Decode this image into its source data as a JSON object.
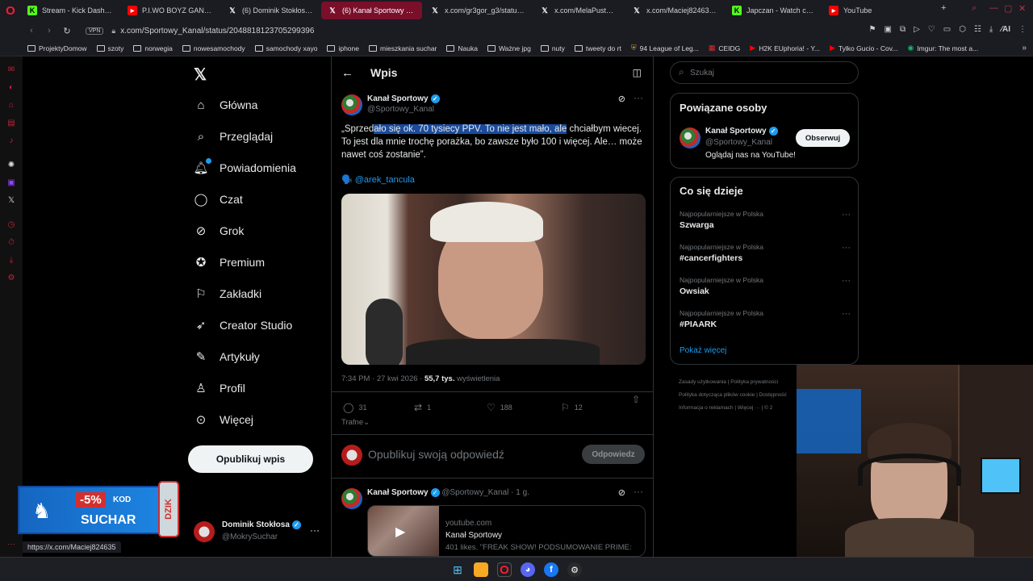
{
  "browser": {
    "tabs": [
      {
        "label": "Stream - Kick Dashboard",
        "icon": "kick-icon",
        "color": "#53fc18"
      },
      {
        "label": "P.I.WO BOYZ GANG - S20",
        "icon": "youtube-icon",
        "color": "#ff0000"
      },
      {
        "label": "(6) Dominik Stokłosa (@M",
        "icon": "x-icon",
        "color": "#ffffff"
      },
      {
        "label": "(6) Kanał Sportowy w ser",
        "icon": "x-icon",
        "color": "#ffffff",
        "active": true
      },
      {
        "label": "x.com/gr3gor_g3/status/2",
        "icon": "x-icon",
        "color": "#ffffff"
      },
      {
        "label": "x.com/MelaPustelnik/stat",
        "icon": "x-icon",
        "color": "#ffffff"
      },
      {
        "label": "x.com/Maciej824635/stat",
        "icon": "x-icon",
        "color": "#ffffff"
      },
      {
        "label": "Japczan - Watch clips on",
        "icon": "kick-icon",
        "color": "#53fc18"
      },
      {
        "label": "YouTube",
        "icon": "youtube-icon",
        "color": "#ff0000"
      }
    ],
    "vpn_label": "VPN",
    "url": "x.com/Sportowy_Kanal/status/2048818123705299396",
    "bookmarks": [
      {
        "label": "ProjektyDomow",
        "icon": "folder-icon"
      },
      {
        "label": "szoty",
        "icon": "folder-icon"
      },
      {
        "label": "norwegia",
        "icon": "folder-icon"
      },
      {
        "label": "nowesamochody",
        "icon": "folder-icon"
      },
      {
        "label": "samochody xayo",
        "icon": "folder-icon"
      },
      {
        "label": "iphone",
        "icon": "folder-icon"
      },
      {
        "label": "mieszkania suchar",
        "icon": "folder-icon"
      },
      {
        "label": "Nauka",
        "icon": "folder-icon"
      },
      {
        "label": "Ważne jpg",
        "icon": "folder-icon"
      },
      {
        "label": "nuty",
        "icon": "folder-icon"
      },
      {
        "label": "tweety do rt",
        "icon": "folder-icon"
      },
      {
        "label": "94 League of Leg...",
        "icon": "league-icon"
      },
      {
        "label": "CEIDG",
        "icon": "ceidg-icon"
      },
      {
        "label": "H2K EUphoria! - Y...",
        "icon": "youtube-icon"
      },
      {
        "label": "Tylko Gucio - Cov...",
        "icon": "youtube-icon"
      },
      {
        "label": "Imgur: The most a...",
        "icon": "imgur-icon"
      }
    ],
    "status_url": "https://x.com/Maciej824635"
  },
  "twitter": {
    "nav": [
      {
        "label": "Główna",
        "icon": "home-icon"
      },
      {
        "label": "Przeglądaj",
        "icon": "search-icon"
      },
      {
        "label": "Powiadomienia",
        "icon": "bell-icon"
      },
      {
        "label": "Czat",
        "icon": "chat-icon"
      },
      {
        "label": "Grok",
        "icon": "grok-icon"
      },
      {
        "label": "Premium",
        "icon": "premium-icon"
      },
      {
        "label": "Zakładki",
        "icon": "bookmark-icon"
      },
      {
        "label": "Creator Studio",
        "icon": "rocket-icon"
      },
      {
        "label": "Artykuły",
        "icon": "article-icon"
      },
      {
        "label": "Profil",
        "icon": "profile-icon"
      },
      {
        "label": "Więcej",
        "icon": "more-icon"
      }
    ],
    "post_button": "Opublikuj wpis",
    "account": {
      "name": "Dominik Stokłosa",
      "handle": "@MokrySuchar"
    },
    "ad": {
      "discount": "-5%",
      "code_label": "KOD",
      "code": "SUCHAR",
      "brand": "DZIK"
    },
    "header_title": "Wpis",
    "tweet": {
      "author": "Kanał Sportowy",
      "handle": "@Sportowy_Kanal",
      "text": "„Sprzedało się ok. 70 tysiecy PPV. To nie jest mało, ale chciałbym wiecej. To jest dla mnie trochę porażka, bo zawsze było 100 i więcej. Ale… może nawet coś zostanie”.",
      "mention": "🗣️ @arek_tancula",
      "time": "7:34 PM · 27 kwi 2026 ·",
      "views_count": "55,7 tys.",
      "views_label": "wyświetlenia",
      "replies": "31",
      "reposts": "1",
      "likes": "188",
      "bookmarks": "12",
      "trafne": "Trafne"
    },
    "reply_box": {
      "placeholder": "Opublikuj swoją odpowiedź",
      "button": "Odpowiedz"
    },
    "next_tweet": {
      "author": "Kanał Sportowy",
      "handle": "@Sportowy_Kanal",
      "time": "· 1 g.",
      "card_domain": "youtube.com",
      "card_title": "Kanał Sportowy",
      "card_desc": "401 likes. \"FREAK SHOW! PODSUMOWANIE PRIME:"
    },
    "search_placeholder": "Szukaj",
    "related": {
      "title": "Powiązane osoby",
      "name": "Kanał Sportowy",
      "handle": "@Sportowy_Kanal",
      "bio": "Oglądaj nas na YouTube!",
      "follow": "Obserwuj"
    },
    "trends": {
      "title": "Co się dzieje",
      "items": [
        {
          "category": "Najpopularniejsze w Polska",
          "name": "Szwarga"
        },
        {
          "category": "Najpopularniejsze w Polska",
          "name": "#cancerfighters"
        },
        {
          "category": "Najpopularniejsze w Polska",
          "name": "Owsiak"
        },
        {
          "category": "Najpopularniejsze w Polska",
          "name": "#PIAARK"
        }
      ],
      "show_more": "Pokaż więcej"
    },
    "footer": [
      "Zasady użytkowania",
      "Polityka prywatności",
      "Polityka dotycząca plików cookie",
      "Dostępność",
      "Informacja o reklamach",
      "Więcej ···",
      "© 2"
    ]
  },
  "colors": {
    "accent": "#1d9bf0",
    "selection": "#1a4b9c",
    "opera": "#ff1b2d"
  }
}
